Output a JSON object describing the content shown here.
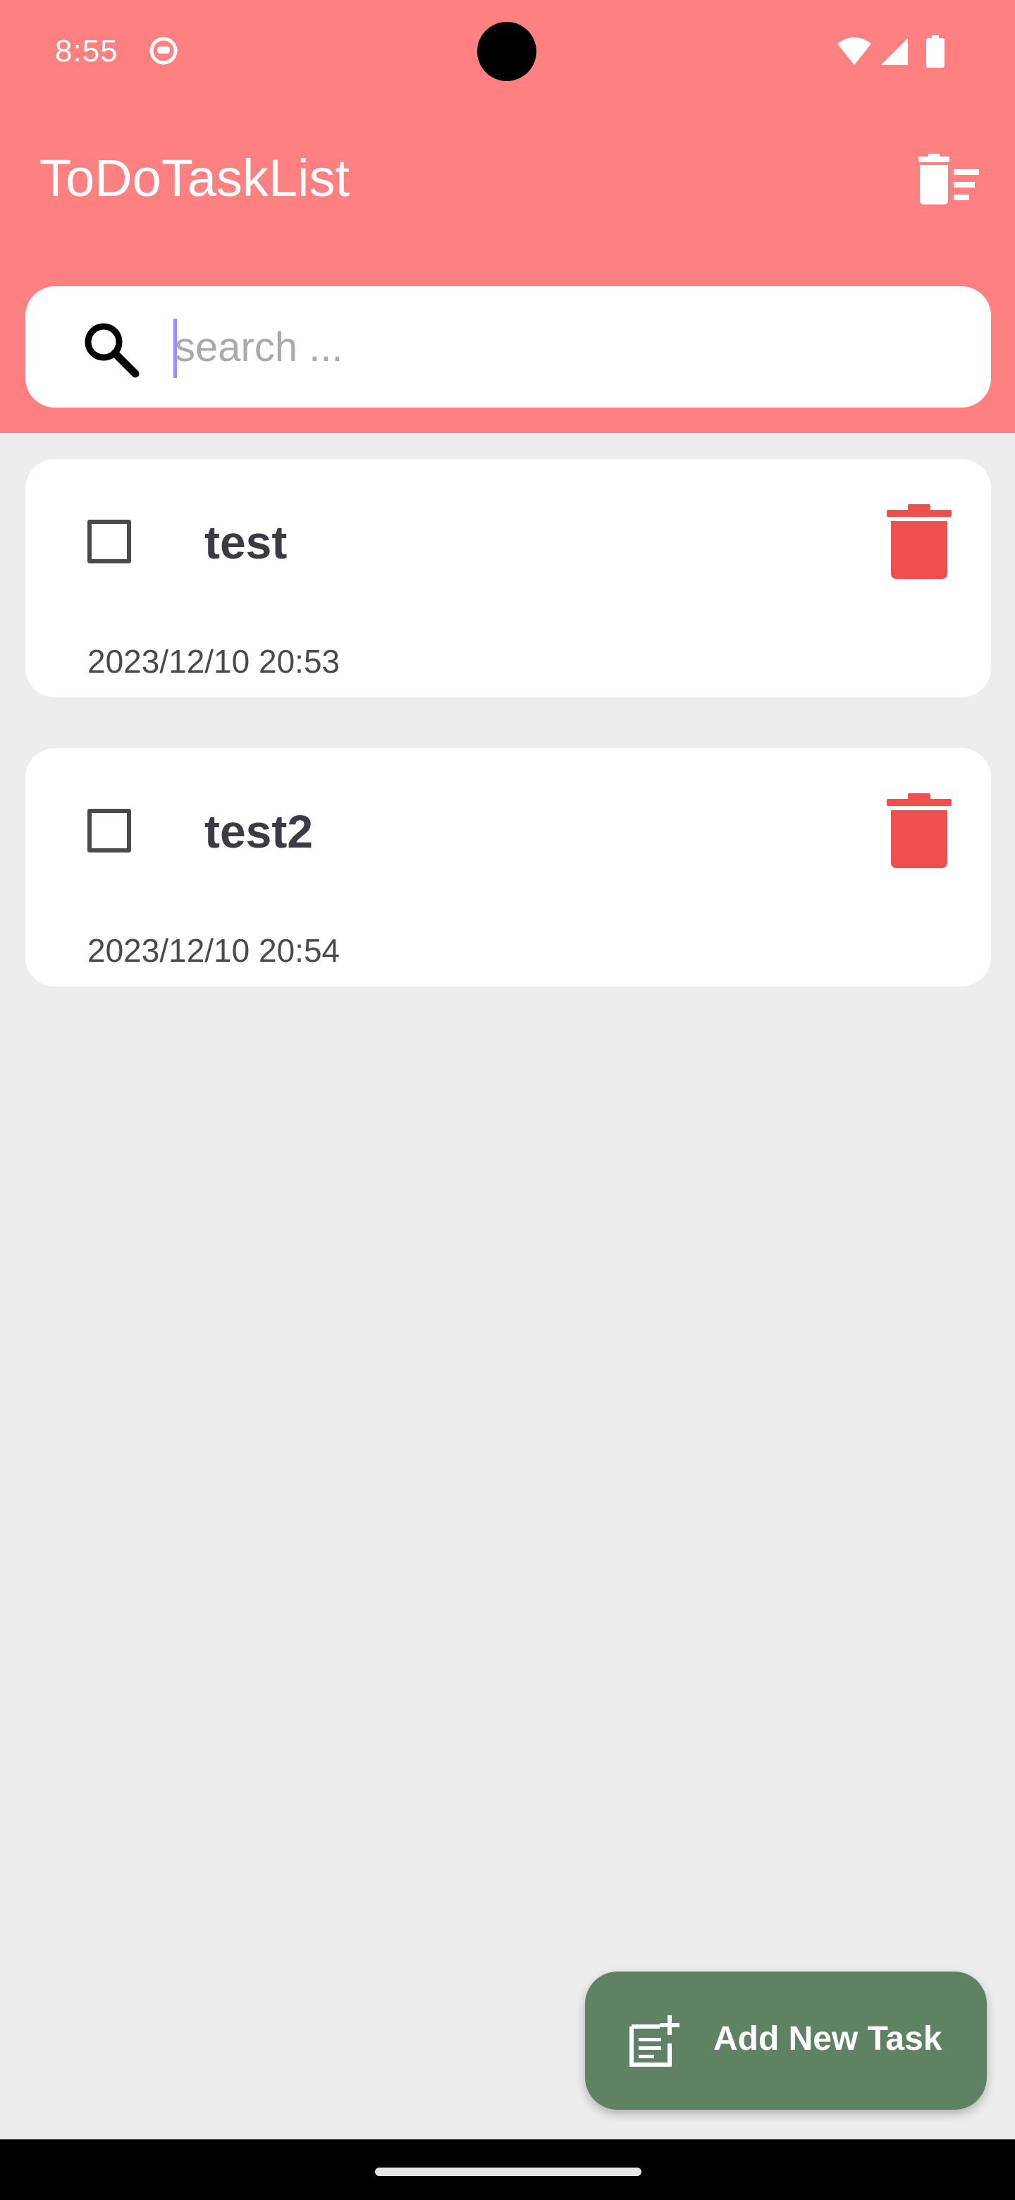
{
  "status_bar": {
    "time": "8:55",
    "icons": [
      "app-notification-icon",
      "wifi-icon",
      "signal-icon",
      "battery-icon"
    ]
  },
  "app_bar": {
    "title": "ToDoTaskList",
    "clear_all_icon": "delete-sweep-icon"
  },
  "search": {
    "placeholder": "search ...",
    "value": "",
    "icon": "search-icon"
  },
  "tasks": [
    {
      "title": "test",
      "date": "2023/12/10 20:53",
      "completed": false
    },
    {
      "title": "test2",
      "date": "2023/12/10 20:54",
      "completed": false
    }
  ],
  "fab": {
    "label": "Add New Task",
    "icon": "note-add-icon"
  },
  "colors": {
    "header": "#ff8080",
    "background": "#ededed",
    "delete": "#ef4f4f",
    "fab": "#5f8264"
  }
}
